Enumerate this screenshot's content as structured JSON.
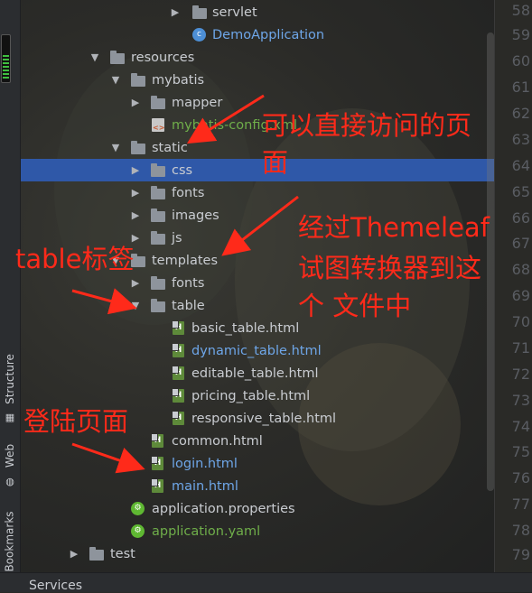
{
  "sidebar_tabs": [
    {
      "label": "Structure",
      "icon": "structure-icon"
    },
    {
      "label": "Web",
      "icon": "web-icon"
    },
    {
      "label": "Bookmarks",
      "icon": "bookmark-icon"
    }
  ],
  "tree": {
    "servlet": "servlet",
    "demo_app": "DemoApplication",
    "resources": "resources",
    "mybatis": "mybatis",
    "mapper": "mapper",
    "mybatis_config": "mybatis-config.xml",
    "static": "static",
    "css": "css",
    "fonts": "fonts",
    "images": "images",
    "js": "js",
    "templates": "templates",
    "t_fonts": "fonts",
    "table": "table",
    "basic_table": "basic_table.html",
    "dynamic_table": "dynamic_table.html",
    "editable_table": "editable_table.html",
    "pricing_table": "pricing_table.html",
    "responsive_table": "responsive_table.html",
    "common": "common.html",
    "login": "login.html",
    "main": "main.html",
    "app_props": "application.properties",
    "app_yaml": "application.yaml",
    "test": "test"
  },
  "line_numbers": [
    "58",
    "59",
    "60",
    "61",
    "62",
    "63",
    "64",
    "65",
    "66",
    "67",
    "68",
    "69",
    "70",
    "71",
    "72",
    "73",
    "74",
    "75",
    "76",
    "77",
    "78",
    "79"
  ],
  "annotations": {
    "static_note_line1": "可以直接访问的页",
    "static_note_line2": "面",
    "templates_note_line1": "经过Themeleaf",
    "templates_note_line2": "试图转换器到这",
    "templates_note_line3": "个 文件中",
    "table_note": "table标签",
    "login_note": "登陆页面"
  },
  "bottom_bar": {
    "services": "Services"
  },
  "colors": {
    "selection": "#2f58a8",
    "annotation": "#ff2a1a",
    "link_blue": "#6ea6e8",
    "config_green": "#6fae4a"
  }
}
